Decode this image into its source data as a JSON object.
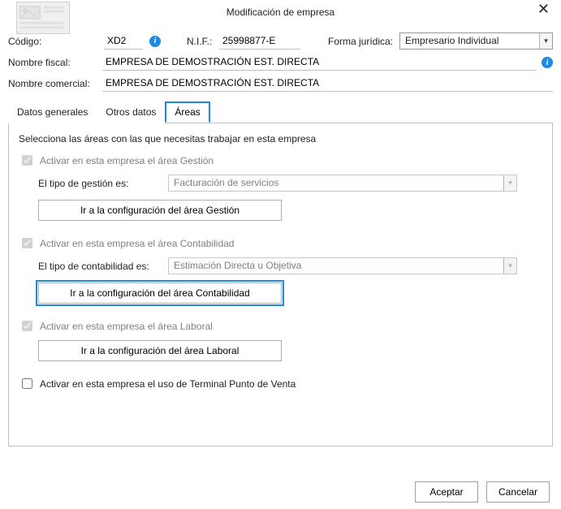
{
  "window": {
    "title": "Modificación de empresa",
    "close": "✕"
  },
  "fields": {
    "codigo_label": "Código:",
    "codigo_value": "XD2",
    "nif_label": "N.I.F.:",
    "nif_value": "25998877-E",
    "forma_label": "Forma jurídica:",
    "forma_value": "Empresario Individual",
    "nombre_fiscal_label": "Nombre fiscal:",
    "nombre_fiscal_value": "EMPRESA DE DEMOSTRACIÓN EST. DIRECTA",
    "nombre_comercial_label": "Nombre comercial:",
    "nombre_comercial_value": "EMPRESA DE DEMOSTRACIÓN EST. DIRECTA"
  },
  "tabs": {
    "datos": "Datos generales",
    "otros": "Otros datos",
    "areas": "Áreas"
  },
  "areas": {
    "instruction": "Selecciona las áreas con las que necesitas trabajar en esta empresa",
    "gestion": {
      "checkbox": "Activar en esta empresa el área Gestión",
      "tipo_label": "El tipo de gestión es:",
      "tipo_value": "Facturación de servicios",
      "button": "Ir a la configuración del área Gestión"
    },
    "contabilidad": {
      "checkbox": "Activar en esta empresa el área Contabilidad",
      "tipo_label": "El tipo de contabilidad es:",
      "tipo_value": "Estimación Directa u Objetiva",
      "button": "Ir a la configuración del área Contabilidad"
    },
    "laboral": {
      "checkbox": "Activar en esta empresa el área Laboral",
      "button": "Ir a la configuración del área Laboral"
    },
    "tpv": {
      "checkbox": "Activar en esta empresa el uso de Terminal Punto de Venta"
    }
  },
  "footer": {
    "accept": "Aceptar",
    "cancel": "Cancelar"
  }
}
